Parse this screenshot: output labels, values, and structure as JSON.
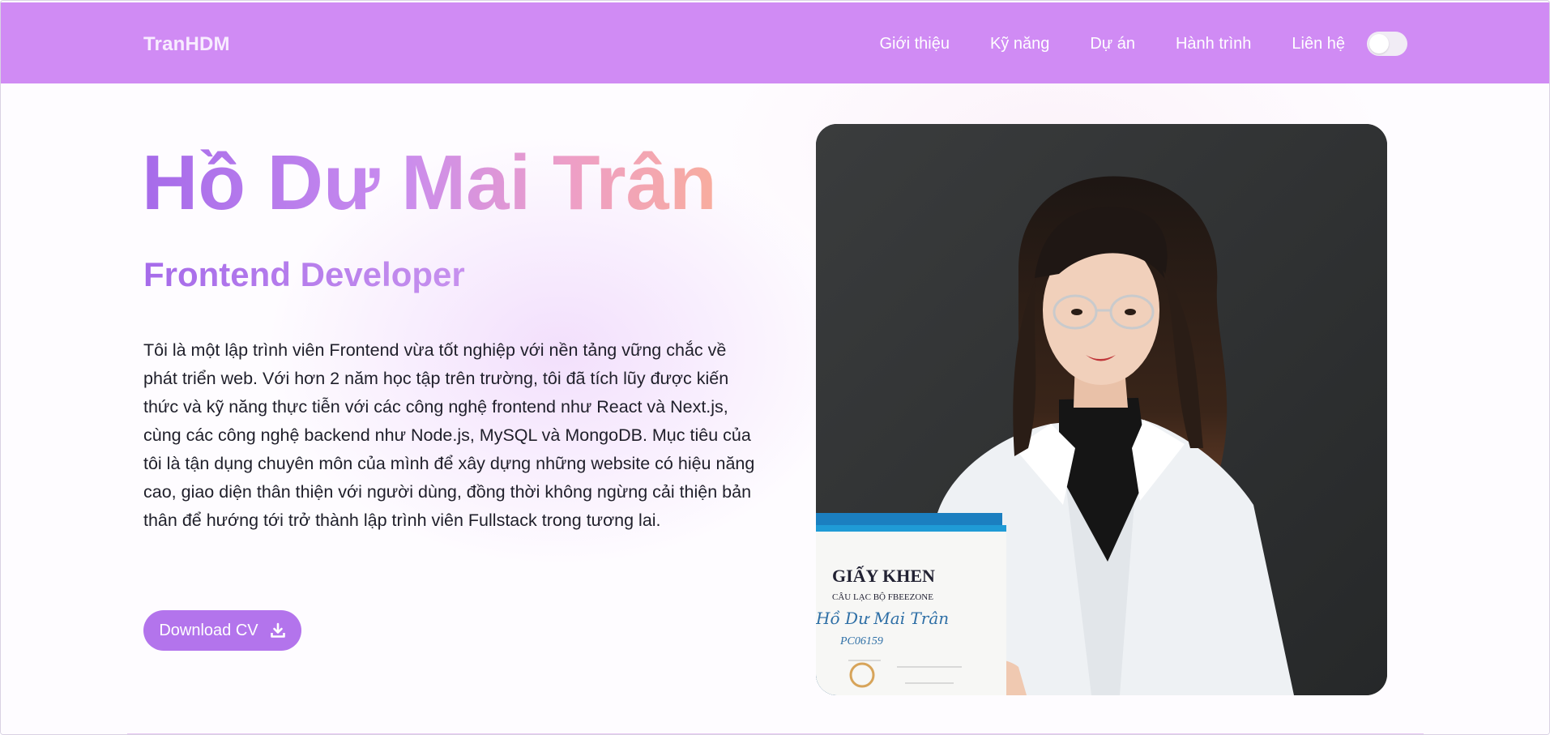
{
  "navbar": {
    "brand": "TranHDM",
    "links": [
      "Giới thiệu",
      "Kỹ năng",
      "Dự án",
      "Hành trình",
      "Liên hệ"
    ],
    "theme_toggle": "off",
    "background_color": "#d08bf4"
  },
  "hero": {
    "name": "Hồ Dư Mai Trân",
    "role": "Frontend Developer",
    "bio": "Tôi là một lập trình viên Frontend vừa tốt nghiệp với nền tảng vững chắc về phát triển web. Với hơn 2 năm học tập trên trường, tôi đã tích lũy được kiến thức và kỹ năng thực tiễn với các công nghệ frontend như React và Next.js, cùng các công nghệ backend như Node.js, MySQL và MongoDB. Mục tiêu của tôi là tận dụng chuyên môn của mình để xây dựng những website có hiệu năng cao, giao diện thân thiện với người dùng, đồng thời không ngừng cải thiện bản thân để hướng tới trở thành lập trình viên Fullstack trong tương lai.",
    "cv_button": "Download CV",
    "cv_icon": "download-icon",
    "accent_color": "#b374ec"
  },
  "photo": {
    "certificate": {
      "title": "GIẤY KHEN",
      "subtitle": "CÂU LẠC BỘ FBEEZONE",
      "recipient": "Hồ Dư Mai Trân",
      "student_id": "PC06159"
    }
  }
}
